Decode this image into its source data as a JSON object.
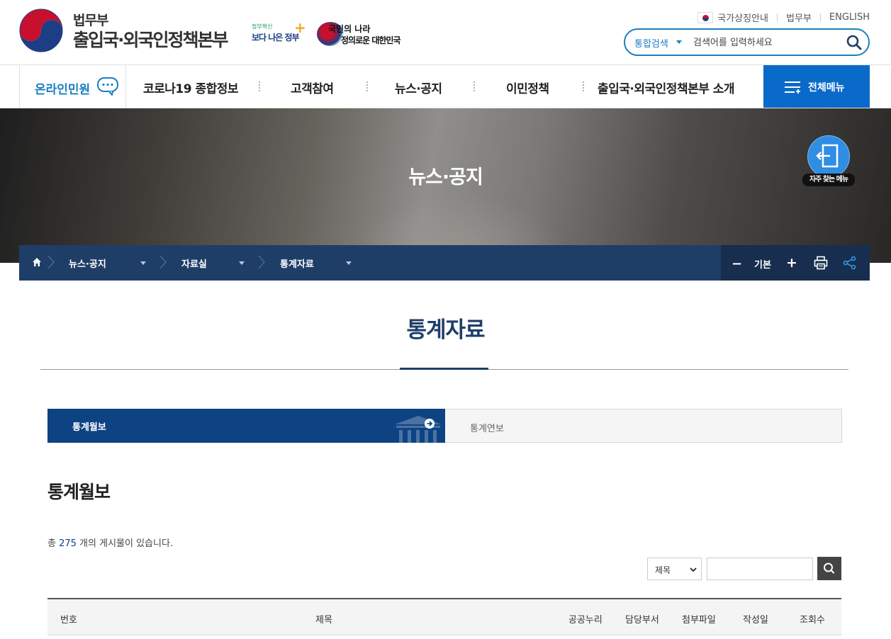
{
  "header": {
    "org_small": "법무부",
    "org_big": "출입국·외국인정책본부",
    "gov_badge_small": "정부혁신",
    "gov_badge_big": "보다 나은 정부",
    "slogan_line1": "국민의 나라",
    "slogan_line2": "정의로운 대한민국",
    "top_links": [
      "국가상징안내",
      "법무부",
      "ENGLISH"
    ],
    "search": {
      "category": "통합검색",
      "placeholder": "검색어를 입력하세요"
    }
  },
  "nav": {
    "online": "온라인민원",
    "items": [
      "코로나19 종합정보",
      "고객참여",
      "뉴스·공지",
      "이민정책",
      "출입국·외국인정책본부 소개"
    ],
    "all_menu": "전체메뉴"
  },
  "banner": {
    "title": "뉴스·공지",
    "fav_menu": "자주 찾는 메뉴"
  },
  "breadcrumb": {
    "items": [
      "뉴스·공지",
      "자료실",
      "통계자료"
    ],
    "font_label": "기본"
  },
  "page": {
    "title": "통계자료",
    "tabs": [
      {
        "label": "통계월보",
        "active": true
      },
      {
        "label": "통계연보",
        "active": false
      }
    ],
    "section_title": "통계월보",
    "count_prefix": "총 ",
    "count_value": "275",
    "count_suffix": " 개의 게시물이 있습니다.",
    "filter": {
      "selected": "제목",
      "input_value": ""
    },
    "table_headers": [
      "번호",
      "제목",
      "공공누리",
      "담당부서",
      "첨부파일",
      "작성일",
      "조회수"
    ]
  },
  "colors": {
    "primary_blue": "#0a6ac9",
    "navy": "#1e3e68",
    "tab_active": "#0e4383",
    "link_blue": "#1a7fc1"
  }
}
